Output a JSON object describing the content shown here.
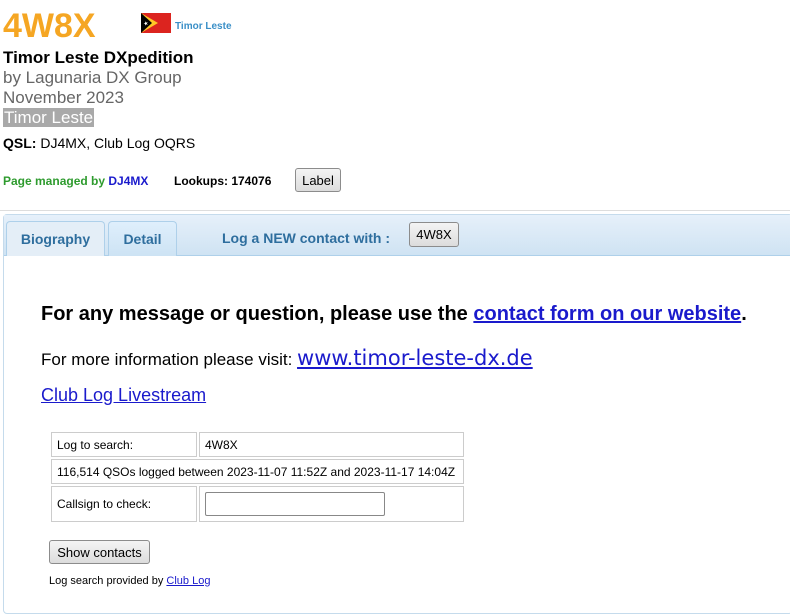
{
  "header": {
    "callsign": "4W8X",
    "country_link": "Timor Leste",
    "title": "Timor Leste DXpedition",
    "byline": "by Lagunaria DX Group",
    "date": "November 2023",
    "country_highlight": "Timor Leste"
  },
  "qsl": {
    "label": "QSL:",
    "value": "DJ4MX, Club Log OQRS"
  },
  "meta": {
    "managed_label": "Page managed by",
    "manager": "DJ4MX",
    "lookups_text": "Lookups: 174076",
    "label_button": "Label"
  },
  "tabs": [
    {
      "label": "Biography"
    },
    {
      "label": "Detail"
    }
  ],
  "log_new": {
    "label": "Log a NEW contact with :",
    "callsign_button": "4W8X"
  },
  "content": {
    "message_prefix": "For any message or question, please use the ",
    "message_link": "contact form on our website",
    "message_suffix": ".",
    "info_prefix": "For more information please visit: ",
    "info_link": "www.timor-leste-dx.de",
    "livestream_link": "Club Log Livestream"
  },
  "search": {
    "log_label": "Log to search:",
    "log_value": "4W8X",
    "summary": "116,514 QSOs logged between 2023-11-07 11:52Z and 2023-11-17 14:04Z",
    "callsign_label": "Callsign to check:",
    "callsign_value": "",
    "show_button": "Show contacts",
    "provided_prefix": "Log search provided by ",
    "provided_link": "Club Log"
  },
  "colors": {
    "callsign": "#f5a623",
    "managed": "#2e9b2e",
    "link": "#1a1acc",
    "tab_text": "#2e6e9e"
  }
}
